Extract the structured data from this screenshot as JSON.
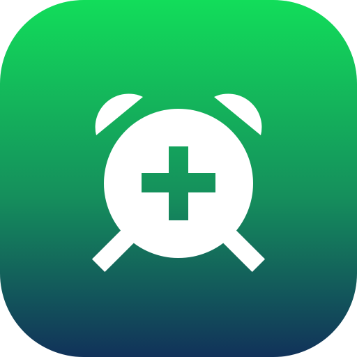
{
  "icon": {
    "name": "add-alarm-icon",
    "description_label": "",
    "colors": {
      "gradient_top": "#12DD5A",
      "gradient_mid": "#158F5C",
      "gradient_bottom": "#11325A",
      "glyph": "#FFFFFF"
    }
  }
}
